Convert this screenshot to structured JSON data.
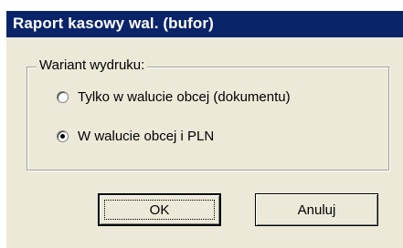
{
  "window": {
    "title": "Raport kasowy wal. (bufor)"
  },
  "group": {
    "legend": "Wariant wydruku:",
    "options": [
      {
        "label": "Tylko w walucie obcej (dokumentu)",
        "checked": false
      },
      {
        "label": "W walucie obcej i PLN",
        "checked": true
      }
    ]
  },
  "buttons": {
    "ok_label": "OK",
    "cancel_label": "Anuluj"
  },
  "colors": {
    "titlebar": "#0a246a",
    "title_text": "#ffffff",
    "dialog_bg": "#ece9d8"
  }
}
